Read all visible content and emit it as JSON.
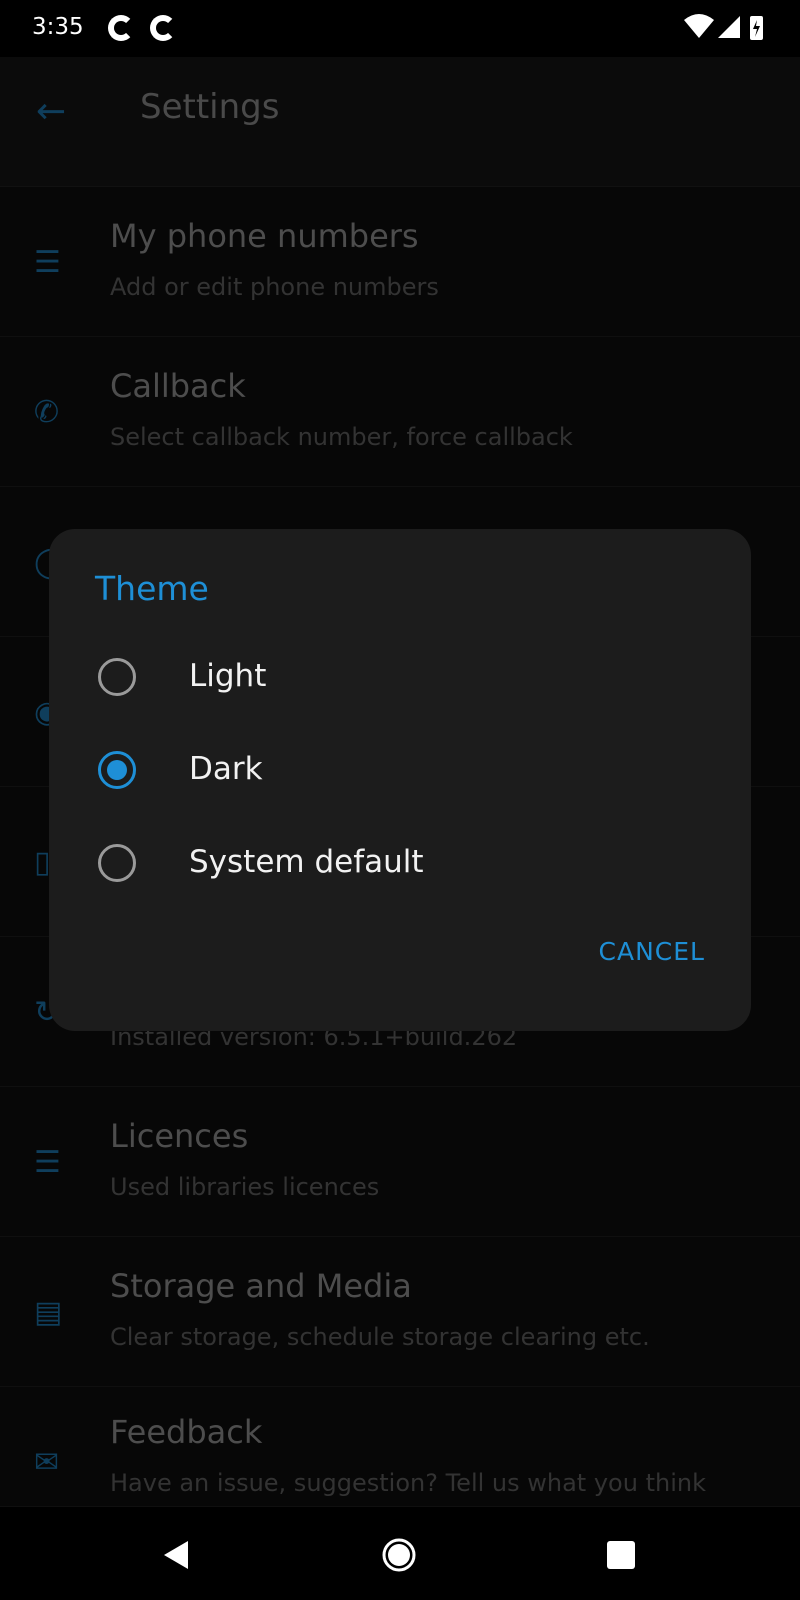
{
  "status_bar": {
    "time": "3:35",
    "icons": [
      "google-icon",
      "google-icon",
      "wifi-icon",
      "signal-icon",
      "battery-charging-icon"
    ]
  },
  "toolbar": {
    "title": "Settings",
    "back_icon": "arrow-left-icon"
  },
  "settings": [
    {
      "title": "My phone numbers",
      "subtitle": "Add or edit phone numbers",
      "icon": "numbered-list-icon"
    },
    {
      "title": "Callback",
      "subtitle": "Select callback number, force callback",
      "icon": "phone-callback-icon"
    },
    {
      "title": "",
      "subtitle": "",
      "icon": "user-circle-icon"
    },
    {
      "title": "",
      "subtitle": "",
      "icon": "circle-icon"
    },
    {
      "title": "",
      "subtitle": "",
      "icon": "device-icon"
    },
    {
      "title": "",
      "subtitle": "Installed version: 6.5.1+build.262",
      "icon": "refresh-icon"
    },
    {
      "title": "Licences",
      "subtitle": "Used libraries licences",
      "icon": "menu-lines-icon"
    },
    {
      "title": "Storage and Media",
      "subtitle": "Clear storage, schedule storage clearing etc.",
      "icon": "storage-icon"
    },
    {
      "title": "Feedback",
      "subtitle": "Have an issue, suggestion? Tell us what you think",
      "icon": "mail-icon"
    }
  ],
  "dialog": {
    "title": "Theme",
    "options": [
      {
        "label": "Light",
        "selected": false
      },
      {
        "label": "Dark",
        "selected": true
      },
      {
        "label": "System default",
        "selected": false
      }
    ],
    "cancel": "CANCEL"
  },
  "colors": {
    "accent": "#1e8fd6"
  }
}
